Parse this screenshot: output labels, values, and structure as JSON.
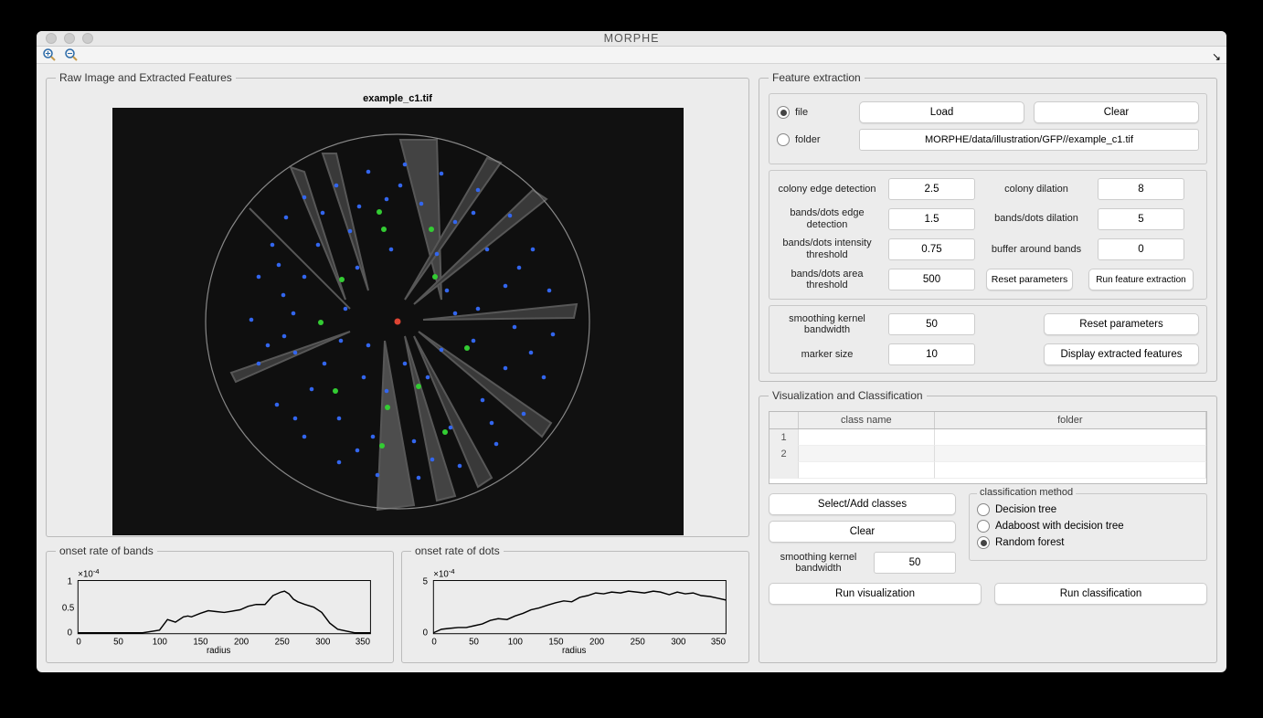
{
  "window": {
    "title": "MORPHE"
  },
  "panels": {
    "raw_image": "Raw Image and Extracted Features",
    "feature_extraction": "Feature extraction",
    "viz_class": "Visualization and Classification"
  },
  "image": {
    "title": "example_c1.tif"
  },
  "file_source": {
    "file_label": "file",
    "folder_label": "folder",
    "selected": "file",
    "load_btn": "Load",
    "clear_btn": "Clear",
    "path": "MORPHE/data/illustration/GFP//example_c1.tif"
  },
  "params": {
    "colony_edge_label": "colony edge detection",
    "colony_edge": "2.5",
    "colony_dilation_label": "colony dilation",
    "colony_dilation": "8",
    "bands_edge_label": "bands/dots edge detection",
    "bands_edge": "1.5",
    "bands_dilation_label": "bands/dots dilation",
    "bands_dilation": "5",
    "intensity_thresh_label": "bands/dots intensity threshold",
    "intensity_thresh": "0.75",
    "buffer_label": "buffer around bands",
    "buffer": "0",
    "area_thresh_label": "bands/dots area threshold",
    "area_thresh": "500",
    "reset_btn": "Reset parameters",
    "run_btn": "Run feature extraction"
  },
  "display": {
    "smooth_label": "smoothing kernel bandwidth",
    "smooth": "50",
    "marker_label": "marker size",
    "marker": "10",
    "reset_btn": "Reset parameters",
    "display_btn": "Display extracted features"
  },
  "charts": {
    "bands": {
      "title": "onset rate of bands",
      "xlabel": "radius",
      "y_exp": "×10",
      "y_sup": "-4"
    },
    "dots": {
      "title": "onset rate of dots",
      "xlabel": "radius",
      "y_exp": "×10",
      "y_sup": "-4"
    }
  },
  "chart_data": [
    {
      "type": "line",
      "title": "onset rate of bands",
      "xlabel": "radius",
      "ylabel": "",
      "y_scale_exponent": -4,
      "xlim": [
        0,
        360
      ],
      "ylim": [
        0,
        1
      ],
      "x_ticks": [
        0,
        50,
        100,
        150,
        200,
        250,
        300,
        350
      ],
      "y_ticks": [
        0,
        0.5,
        1
      ],
      "x": [
        0,
        20,
        40,
        60,
        80,
        100,
        110,
        120,
        130,
        135,
        140,
        150,
        160,
        170,
        180,
        200,
        210,
        220,
        230,
        240,
        250,
        255,
        260,
        265,
        270,
        280,
        290,
        300,
        310,
        320,
        340,
        360
      ],
      "y": [
        0.02,
        0.02,
        0.02,
        0.02,
        0.02,
        0.05,
        0.25,
        0.2,
        0.3,
        0.32,
        0.3,
        0.38,
        0.44,
        0.42,
        0.4,
        0.45,
        0.52,
        0.55,
        0.55,
        0.72,
        0.78,
        0.8,
        0.75,
        0.65,
        0.6,
        0.55,
        0.5,
        0.4,
        0.2,
        0.08,
        0.02,
        0.02
      ]
    },
    {
      "type": "line",
      "title": "onset rate of dots",
      "xlabel": "radius",
      "ylabel": "",
      "y_scale_exponent": -4,
      "xlim": [
        0,
        360
      ],
      "ylim": [
        0,
        5
      ],
      "x_ticks": [
        0,
        50,
        100,
        150,
        200,
        250,
        300,
        350
      ],
      "y_ticks": [
        0,
        5
      ],
      "x": [
        0,
        10,
        20,
        30,
        40,
        50,
        60,
        70,
        80,
        90,
        100,
        110,
        120,
        130,
        140,
        150,
        160,
        170,
        180,
        190,
        200,
        210,
        220,
        230,
        240,
        250,
        260,
        270,
        280,
        290,
        300,
        310,
        320,
        330,
        340,
        350,
        360
      ],
      "y": [
        0.1,
        0.3,
        0.4,
        0.5,
        0.5,
        0.7,
        0.9,
        1.2,
        1.4,
        1.3,
        1.7,
        1.9,
        2.2,
        2.4,
        2.6,
        2.9,
        3.1,
        3.0,
        3.4,
        3.6,
        3.8,
        3.7,
        3.9,
        3.8,
        4.0,
        3.9,
        3.8,
        4.0,
        3.9,
        3.7,
        3.9,
        3.7,
        3.8,
        3.6,
        3.5,
        3.3,
        3.2
      ]
    }
  ],
  "viz": {
    "table": {
      "col1": "class name",
      "col2": "folder",
      "rows": [
        "1",
        "2"
      ]
    },
    "select_btn": "Select/Add classes",
    "clear_btn": "Clear",
    "smooth_label": "smoothing kernel bandwidth",
    "smooth": "50",
    "run_viz_btn": "Run visualization",
    "run_class_btn": "Run classification",
    "method_title": "classification method",
    "methods": {
      "decision_tree": "Decision tree",
      "adaboost": "Adaboost with decision tree",
      "random_forest": "Random forest"
    },
    "selected_method": "random_forest"
  }
}
